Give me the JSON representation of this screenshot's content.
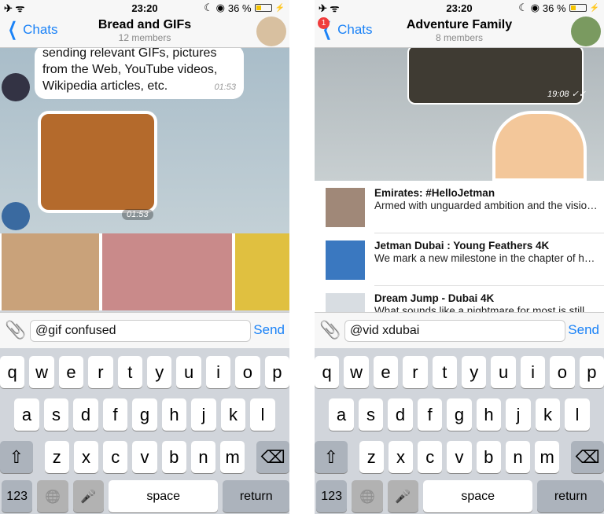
{
  "phones": [
    {
      "status": {
        "time": "23:20",
        "battery": "36 %",
        "battery_level": 0.36
      },
      "nav": {
        "back": "Chats",
        "badge": "",
        "title": "Bread and GIFs",
        "subtitle": "12 members"
      },
      "chat": {
        "message": "sending relevant GIFs, pictures from the Web, YouTube videos, Wikipedia articles, etc.",
        "message_time": "01:53",
        "sticker_time": "01:53"
      },
      "input": {
        "value": "@gif confused",
        "send": "Send"
      }
    },
    {
      "status": {
        "time": "23:20",
        "battery": "36 %",
        "battery_level": 0.36
      },
      "nav": {
        "back": "Chats",
        "badge": "1",
        "title": "Adventure Family",
        "subtitle": "8 members"
      },
      "chat": {
        "photo_time": "19:08"
      },
      "results": [
        {
          "title": "Emirates: #HelloJetman",
          "desc": "Armed with unguarded ambition and the vision to push boundaries beyond the unth..."
        },
        {
          "title": "Jetman Dubai : Young Feathers 4K",
          "desc": "We mark a new milestone in the chapter of human flight. Join Jetman Yves Rossy and..."
        },
        {
          "title": "Dream Jump - Dubai 4K",
          "desc": "What sounds like a nightmare for most is still"
        }
      ],
      "input": {
        "value": "@vid xdubai",
        "send": "Send"
      }
    }
  ],
  "keyboard": {
    "row1": [
      "q",
      "w",
      "e",
      "r",
      "t",
      "y",
      "u",
      "i",
      "o",
      "p"
    ],
    "row2": [
      "a",
      "s",
      "d",
      "f",
      "g",
      "h",
      "j",
      "k",
      "l"
    ],
    "row3": [
      "z",
      "x",
      "c",
      "v",
      "b",
      "n",
      "m"
    ],
    "shift": "⇧",
    "delete": "⌫",
    "numbers": "123",
    "globe": "🌐",
    "mic": "🎤",
    "space": "space",
    "return": "return"
  },
  "colors": {
    "accent": "#1a82f7",
    "badge": "#f03c3c"
  }
}
